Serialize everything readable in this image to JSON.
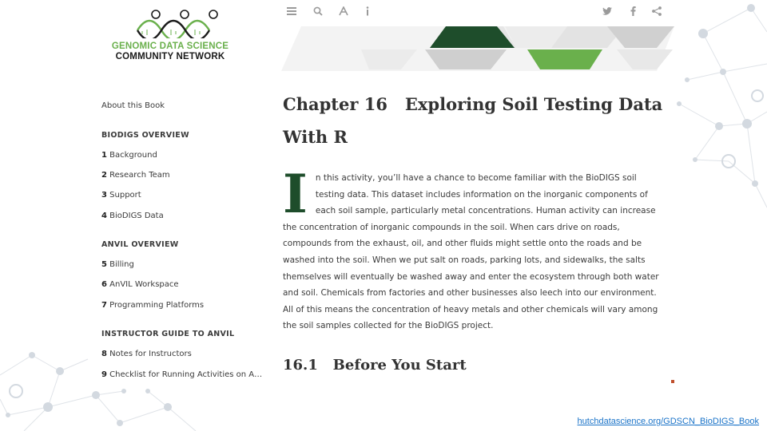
{
  "logo": {
    "line1": "GENOMIC DATA SCIENCE",
    "line2": "COMMUNITY NETWORK",
    "colors": {
      "green": "#6ab04c",
      "dark": "#1a1a1a"
    }
  },
  "toolbar": {
    "icons": [
      "menu-icon",
      "search-icon",
      "font-icon",
      "info-icon",
      "twitter-icon",
      "facebook-icon",
      "share-icon"
    ]
  },
  "sidebar": {
    "about": "About this Book",
    "sections": [
      {
        "title": "BIODIGS OVERVIEW",
        "items": [
          {
            "num": "1",
            "label": "Background"
          },
          {
            "num": "2",
            "label": "Research Team"
          },
          {
            "num": "3",
            "label": "Support"
          },
          {
            "num": "4",
            "label": "BioDIGS Data"
          }
        ]
      },
      {
        "title": "ANVIL OVERVIEW",
        "items": [
          {
            "num": "5",
            "label": "Billing"
          },
          {
            "num": "6",
            "label": "AnVIL Workspace"
          },
          {
            "num": "7",
            "label": "Programming Platforms"
          }
        ]
      },
      {
        "title": "INSTRUCTOR GUIDE TO ANVIL",
        "items": [
          {
            "num": "8",
            "label": "Notes for Instructors"
          },
          {
            "num": "9",
            "label": "Checklist for Running Activities on AnVIL"
          }
        ]
      }
    ]
  },
  "main": {
    "chapter_label": "Chapter 16",
    "chapter_title": "Exploring Soil Testing Data With R",
    "dropcap": "I",
    "paragraph_rest": "n this activity, you’ll have a chance to become familiar with the BioDIGS soil testing data. This dataset includes information on the inorganic components of each soil sample, particularly metal concentrations. Human activity can increase the concentration of inorganic compounds in the soil. When cars drive on roads, compounds from the exhaust, oil, and other fluids might settle onto the roads and be washed into the soil. When we put salt on roads, parking lots, and sidewalks, the salts themselves will eventually be washed away and enter the ecosystem through both water and soil. Chemicals from factories and other businesses also leech into our environment. All of this means the concentration of heavy metals and other chemicals will vary among the soil samples collected for the BioDIGS project.",
    "section_number": "16.1",
    "section_title": "Before You Start"
  },
  "footer": {
    "link": "hutchdatascience.org/GDSCN_BioDIGS_Book"
  },
  "colors": {
    "dark_green": "#1e4d2b",
    "light_green": "#6ab04c",
    "banner_gray": "#d8d8d8",
    "link_blue": "#1a73c8"
  }
}
